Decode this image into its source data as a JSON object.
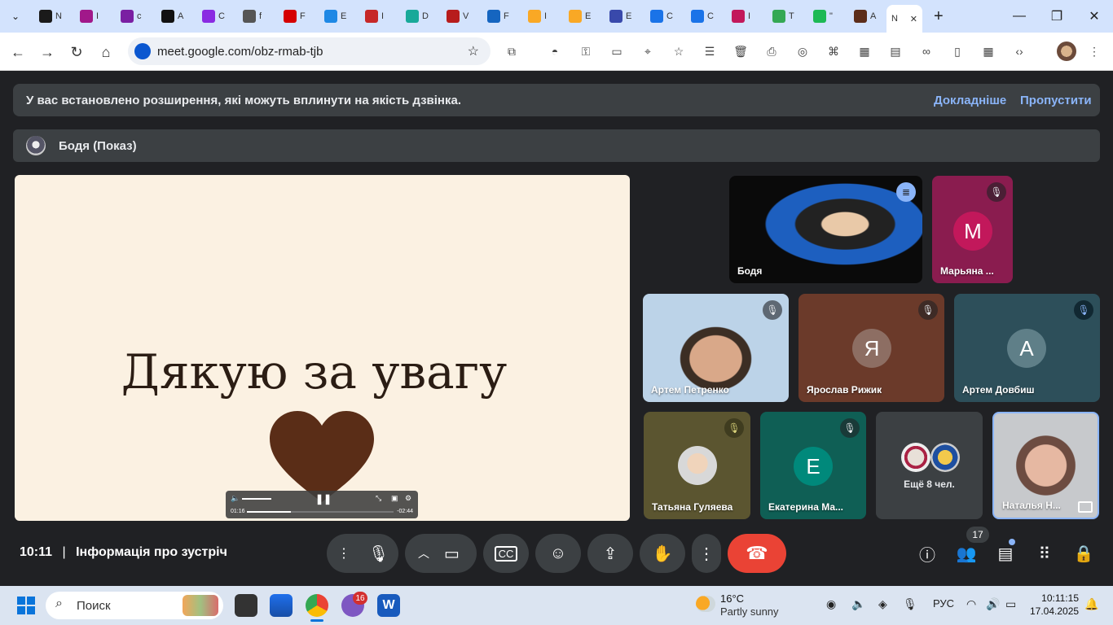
{
  "browser": {
    "tabs": [
      {
        "label": "N",
        "color": "#1a1a1a"
      },
      {
        "label": "I",
        "color": "#a1188a"
      },
      {
        "label": "c",
        "color": "#7a1fa2"
      },
      {
        "label": "A",
        "color": "#111111"
      },
      {
        "label": "C",
        "color": "#8a2be2"
      },
      {
        "label": "f",
        "color": "#555555"
      },
      {
        "label": "F",
        "color": "#d50000"
      },
      {
        "label": "E",
        "color": "#1e88e5"
      },
      {
        "label": "I",
        "color": "#c62828"
      },
      {
        "label": "D",
        "color": "#18a999"
      },
      {
        "label": "V",
        "color": "#b71c1c"
      },
      {
        "label": "F",
        "color": "#1565c0"
      },
      {
        "label": "I",
        "color": "#f9a825"
      },
      {
        "label": "E",
        "color": "#f9a825"
      },
      {
        "label": "E",
        "color": "#3949ab"
      },
      {
        "label": "C",
        "color": "#1a73e8"
      },
      {
        "label": "C",
        "color": "#1a73e8"
      },
      {
        "label": "I",
        "color": "#c2185b"
      },
      {
        "label": "T",
        "color": "#34a853"
      },
      {
        "label": "\"",
        "color": "#1db954"
      },
      {
        "label": "A",
        "color": "#5c2d1a"
      }
    ],
    "active_tab_label": "N",
    "url": "meet.google.com/obz-rmab-tjb"
  },
  "banner": {
    "text": "У вас встановлено розширення, які можуть вплинути на якість дзвінка.",
    "learn_more": "Докладніше",
    "skip": "Пропустити"
  },
  "presenter": {
    "name": "Бодя (Показ)"
  },
  "slide": {
    "title": "Дякую за  увагу",
    "time_elapsed": "01:16",
    "time_remaining": "-02:44",
    "progress": 0.3
  },
  "participants": [
    {
      "name": "Бодя",
      "type": "video",
      "speaking": true
    },
    {
      "name": "Марьяна ...",
      "letter": "M",
      "muted": true
    },
    {
      "name": "Артем Петренко",
      "type": "video",
      "muted": true
    },
    {
      "name": "Ярослав Рижик",
      "letter": "Я",
      "muted": true
    },
    {
      "name": "Артем Довбиш",
      "letter": "A",
      "muted": true
    },
    {
      "name": "Татьяна Гуляева",
      "type": "photo",
      "muted": true
    },
    {
      "name": "Екатерина Ма...",
      "letter": "E",
      "muted": true
    },
    {
      "name": "Ещё 8 чел."
    },
    {
      "name": "Наталья Н...",
      "type": "video"
    }
  ],
  "meeting": {
    "time": "10:11",
    "separator": "|",
    "info": "Інформація про зустріч",
    "people_count": "17"
  },
  "taskbar": {
    "search": "Поиск",
    "weather_temp": "16°C",
    "weather_desc": "Partly sunny",
    "language": "РУС",
    "clock_time": "10:11:15",
    "clock_date": "17.04.2025",
    "notif_count": "16"
  }
}
